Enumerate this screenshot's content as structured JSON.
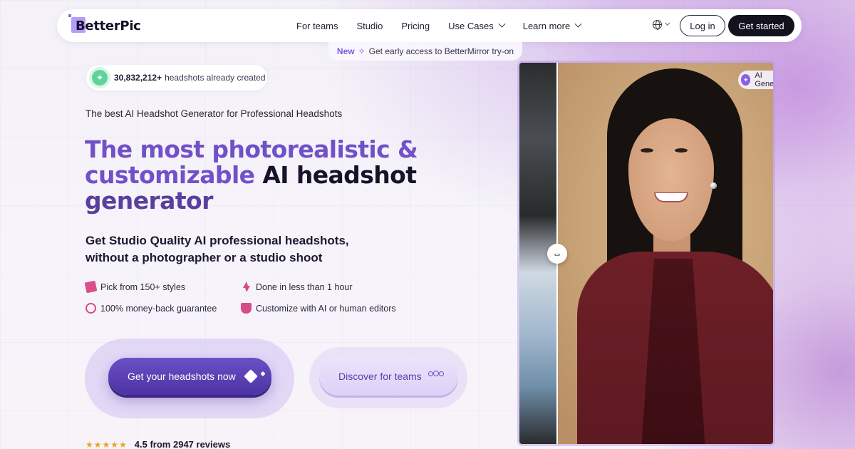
{
  "nav": {
    "logo": "BetterPic",
    "links": [
      "For teams",
      "Studio",
      "Pricing",
      "Use Cases",
      "Learn more"
    ],
    "login": "Log in",
    "get_started": "Get started"
  },
  "announce": {
    "badge": "New",
    "text": "Get early access to BetterMirror try-on"
  },
  "counter": {
    "number": "30,832,212+",
    "label": "headshots already created"
  },
  "hero": {
    "eyebrow": "The best AI Headshot Generator for Professional Headshots",
    "headline_1": "The most photorealistic &",
    "headline_2": "customizable",
    "headline_3": "AI headshot",
    "headline_4": "generator",
    "sub": "Get Studio Quality AI professional headshots, without a photographer or a studio shoot"
  },
  "features": [
    "Pick from 150+ styles",
    "Done in less than 1 hour",
    "100% money-back guarantee",
    "Customize with AI or human editors"
  ],
  "cta": {
    "primary": "Get your headshots now",
    "secondary": "Discover for teams"
  },
  "rating": {
    "stars": "★★★★★",
    "score": "4.5 from 2947 reviews",
    "value": 4.5
  },
  "photo": {
    "badge": "AI Generated"
  },
  "colors": {
    "brand": "#6b4fc6",
    "dark": "#15121f",
    "accent_pink": "#d64c86"
  }
}
